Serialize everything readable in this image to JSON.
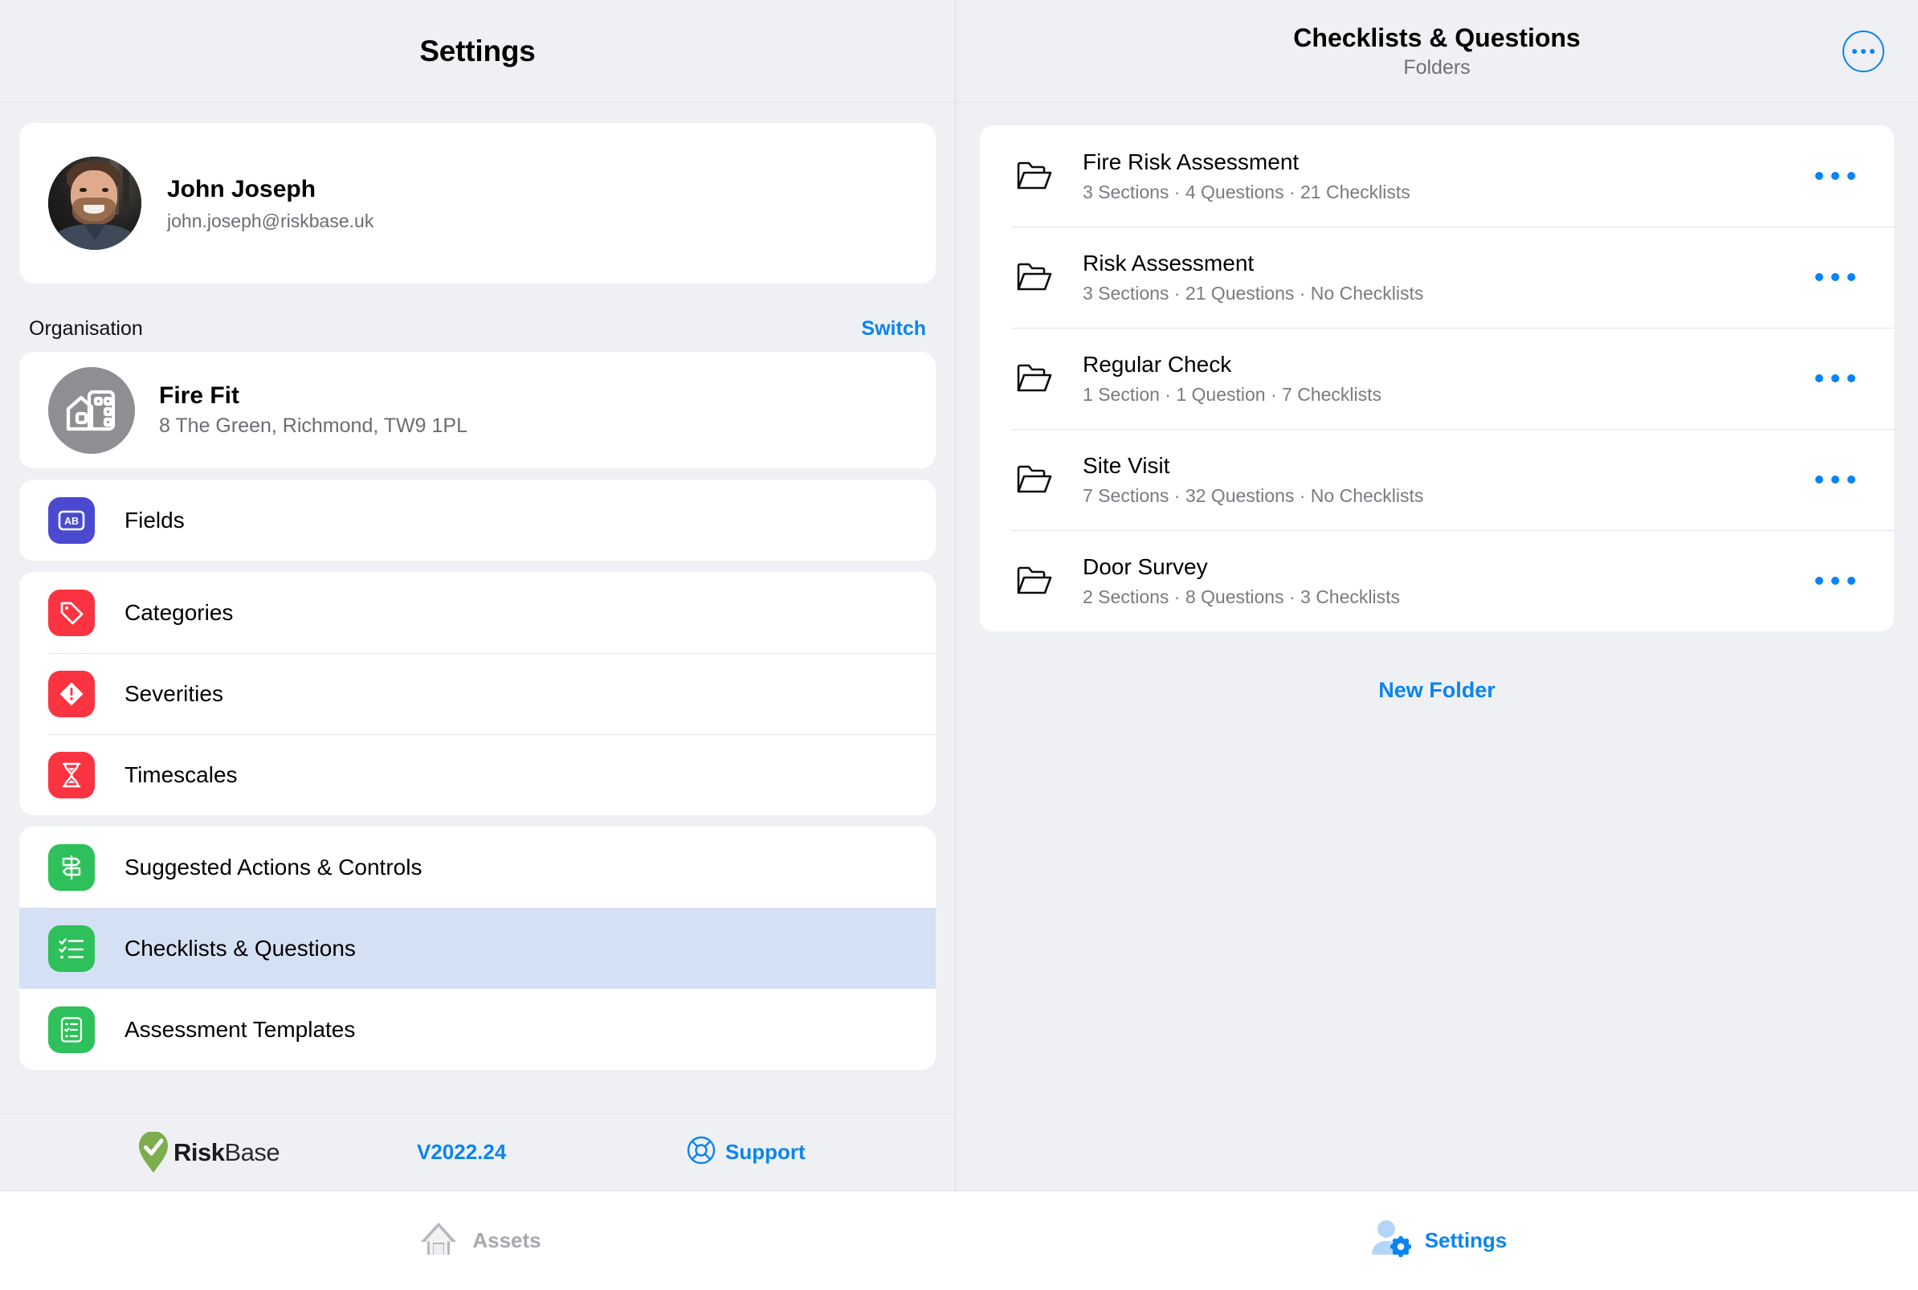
{
  "colors": {
    "accent_blue": "#0a84f0",
    "page_bg": "#eff0f4",
    "card_bg": "#ffffff",
    "selected_row": "#d4e0f3",
    "icon_indigo": "#4a4ad1",
    "icon_red": "#fc3340",
    "icon_green": "#2ec05a",
    "org_grey": "#8e8e93",
    "logo_green": "#7dad4c",
    "muted_text": "#6c6c72"
  },
  "left_panel": {
    "header_title": "Settings",
    "profile": {
      "name": "John Joseph",
      "email": "john.joseph@riskbase.uk"
    },
    "organisation_label": "Organisation",
    "switch_label": "Switch",
    "organisation": {
      "name": "Fire Fit",
      "address": "8 The Green, Richmond, TW9 1PL"
    },
    "menu_groups": [
      {
        "items": [
          {
            "label": "Fields",
            "icon": "ab-field-icon",
            "color": "#4a4ad1",
            "selected": false
          }
        ]
      },
      {
        "items": [
          {
            "label": "Categories",
            "icon": "tag-icon",
            "color": "#fc3340",
            "selected": false
          },
          {
            "label": "Severities",
            "icon": "warning-diamond-icon",
            "color": "#fc3340",
            "selected": false
          },
          {
            "label": "Timescales",
            "icon": "hourglass-icon",
            "color": "#fc3340",
            "selected": false
          }
        ]
      },
      {
        "items": [
          {
            "label": "Suggested Actions & Controls",
            "icon": "signpost-icon",
            "color": "#2ec05a",
            "selected": false
          },
          {
            "label": "Checklists & Questions",
            "icon": "checklist-icon",
            "color": "#2ec05a",
            "selected": true
          },
          {
            "label": "Assessment Templates",
            "icon": "clipboard-list-icon",
            "color": "#2ec05a",
            "selected": false
          }
        ]
      }
    ],
    "footer": {
      "brand_bold": "Risk",
      "brand_light": "Base",
      "version": "V2022.24",
      "support_label": "Support"
    }
  },
  "right_panel": {
    "title": "Checklists & Questions",
    "subtitle": "Folders",
    "more_button": "more-options-icon",
    "folders": [
      {
        "name": "Fire Risk Assessment",
        "meta": "3 Sections · 4 Questions · 21 Checklists"
      },
      {
        "name": "Risk Assessment",
        "meta": "3 Sections · 21 Questions · No Checklists"
      },
      {
        "name": "Regular Check",
        "meta": "1 Section · 1 Question · 7 Checklists"
      },
      {
        "name": "Site Visit",
        "meta": "7 Sections · 32 Questions · No Checklists"
      },
      {
        "name": "Door Survey",
        "meta": "2 Sections · 8 Questions · 3 Checklists"
      }
    ],
    "new_folder_label": "New Folder"
  },
  "tabbar": {
    "tabs": [
      {
        "label": "Assets",
        "icon": "house-icon",
        "active": false
      },
      {
        "label": "Settings",
        "icon": "person-gear-icon",
        "active": true
      }
    ]
  }
}
